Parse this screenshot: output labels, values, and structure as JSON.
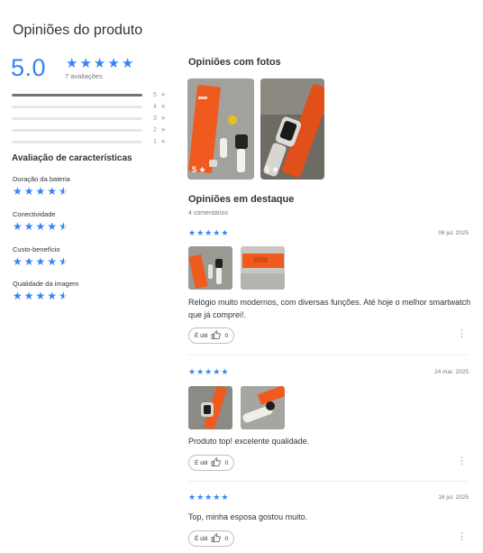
{
  "page_title": "Opiniões do produto",
  "summary": {
    "average": "5.0",
    "ratings_count": "7 avaliações",
    "stars": [
      "full",
      "full",
      "full",
      "full",
      "full"
    ],
    "distribution": [
      {
        "label": "5",
        "fraction": 1.0
      },
      {
        "label": "4",
        "fraction": 0.0
      },
      {
        "label": "3",
        "fraction": 0.0
      },
      {
        "label": "2",
        "fraction": 0.0
      },
      {
        "label": "1",
        "fraction": 0.0
      }
    ]
  },
  "characteristics": {
    "heading": "Avaliação de características",
    "items": [
      {
        "label": "Duração da bateria",
        "stars": [
          "full",
          "full",
          "full",
          "full",
          "half"
        ]
      },
      {
        "label": "Conectividade",
        "stars": [
          "full",
          "full",
          "full",
          "full",
          "half"
        ]
      },
      {
        "label": "Custo-benefício",
        "stars": [
          "full",
          "full",
          "full",
          "full",
          "half"
        ]
      },
      {
        "label": "Qualidade da imagem",
        "stars": [
          "full",
          "full",
          "full",
          "full",
          "half"
        ]
      }
    ]
  },
  "photos_section": {
    "heading": "Opiniões com fotos",
    "photos": [
      {
        "rating": "5",
        "star_icon": "star-icon"
      },
      {
        "rating": "5",
        "star_icon": "star-icon"
      }
    ]
  },
  "featured": {
    "heading": "Opiniões em destaque",
    "comments_count": "4 comentários",
    "useful_label": "É útil",
    "reviews": [
      {
        "date": "06 jul. 2025",
        "stars": [
          "full",
          "full",
          "full",
          "full",
          "full"
        ],
        "text": "Relógio muito modernos, com diversas funções. Até hoje o melhor smartwatch que já comprei!.",
        "useful_count": "0",
        "has_photos": true
      },
      {
        "date": "24 mar. 2025",
        "stars": [
          "full",
          "full",
          "full",
          "full",
          "full"
        ],
        "text": "Produto top! excelente qualidade.",
        "useful_count": "0",
        "has_photos": true
      },
      {
        "date": "16 jul. 2025",
        "stars": [
          "full",
          "full",
          "full",
          "full",
          "full"
        ],
        "text": "Top, minha esposa gostou muito.",
        "useful_count": "0",
        "has_photos": false
      }
    ]
  },
  "colors": {
    "accent_blue": "#3483fa",
    "strap_orange": "#f05a1e"
  }
}
